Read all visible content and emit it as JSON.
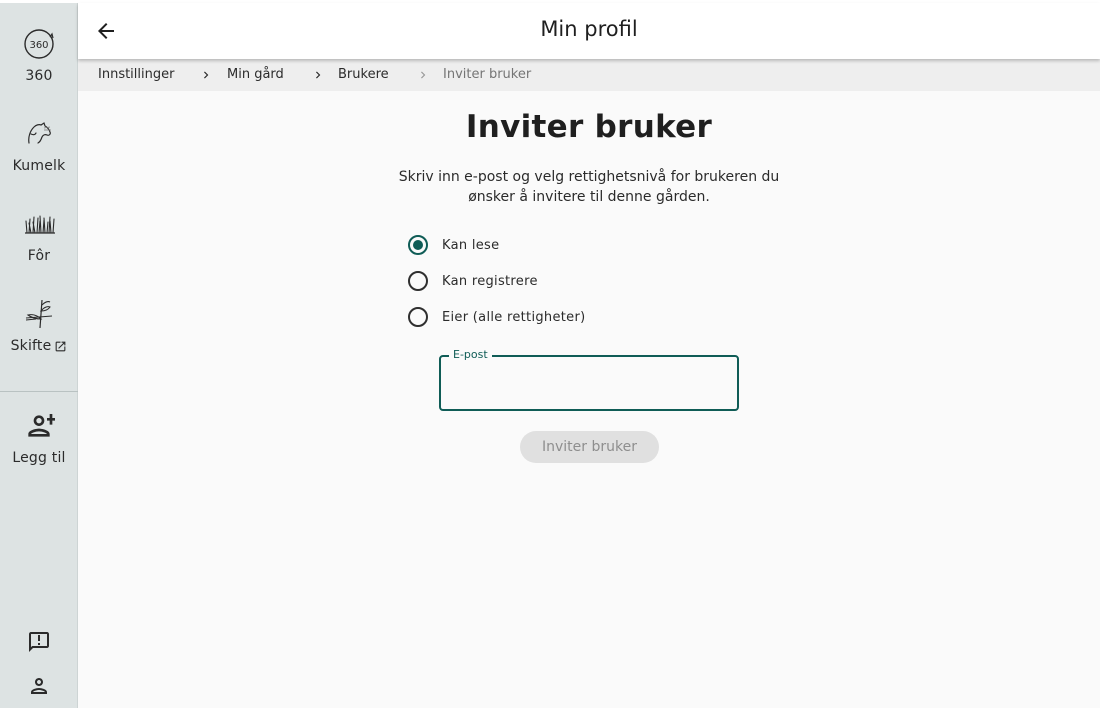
{
  "sidebar": {
    "items": [
      {
        "label": "360",
        "icon": "360-icon"
      },
      {
        "label": "Kumelk",
        "icon": "cow-icon"
      },
      {
        "label": "Fôr",
        "icon": "grass-icon"
      },
      {
        "label": "Skifte",
        "icon": "plant-icon",
        "external": "open-in-new-icon"
      },
      {
        "label": "Legg til",
        "icon": "add-person-icon"
      }
    ],
    "bottom_icons": [
      "feedback-icon",
      "account-icon"
    ]
  },
  "appbar": {
    "title": "Min profil"
  },
  "breadcrumb": {
    "items": [
      "Innstillinger",
      "Min gård",
      "Brukere",
      "Inviter bruker"
    ]
  },
  "main": {
    "title": "Inviter bruker",
    "description": "Skriv inn e-post og velg rettighetsnivå for brukeren du ønsker å invitere til denne gården.",
    "radios": [
      {
        "label": "Kan lese",
        "checked": true
      },
      {
        "label": "Kan registrere",
        "checked": false
      },
      {
        "label": "Eier (alle rettigheter)",
        "checked": false
      }
    ],
    "email": {
      "label": "E-post",
      "value": ""
    },
    "submit_label": "Inviter bruker"
  },
  "colors": {
    "accent": "#0f5c56",
    "sidebar_bg": "#dde3e3"
  }
}
